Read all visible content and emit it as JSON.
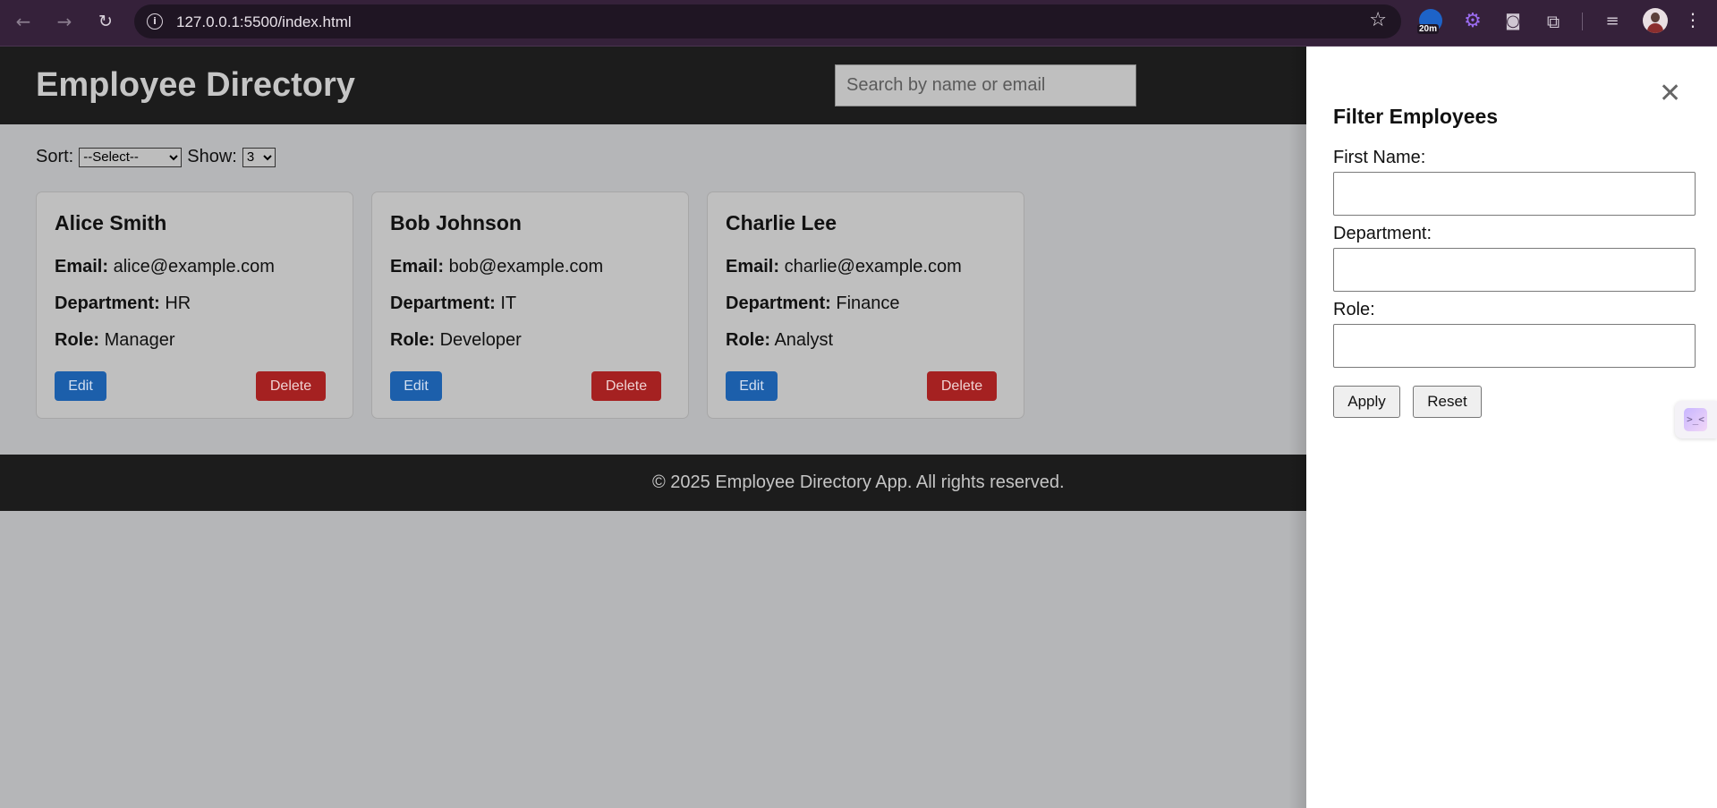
{
  "browser": {
    "url": "127.0.0.1:5500/index.html",
    "extension_badge": "20m",
    "icons": [
      "back-arrow-icon",
      "forward-arrow-icon",
      "reload-icon",
      "info-icon",
      "star-icon",
      "gear-icon",
      "camera-icon",
      "puzzle-icon",
      "queue-icon",
      "kebab-menu-icon"
    ]
  },
  "header": {
    "title": "Employee Directory",
    "search_placeholder": "Search by name or email"
  },
  "controls": {
    "sort_label": "Sort:",
    "sort_value": "--Select--",
    "show_label": "Show:",
    "show_value": "3"
  },
  "labels": {
    "email": "Email:",
    "department": "Department:",
    "role": "Role:"
  },
  "employees": [
    {
      "name": "Alice Smith",
      "email": "alice@example.com",
      "department": "HR",
      "role": "Manager"
    },
    {
      "name": "Bob Johnson",
      "email": "bob@example.com",
      "department": "IT",
      "role": "Developer"
    },
    {
      "name": "Charlie Lee",
      "email": "charlie@example.com",
      "department": "Finance",
      "role": "Analyst"
    }
  ],
  "card_actions": {
    "edit": "Edit",
    "delete": "Delete"
  },
  "footer": {
    "text": "© 2025 Employee Directory App. All rights reserved."
  },
  "filter_panel": {
    "title": "Filter Employees",
    "close": "✕",
    "first_name_label": "First Name:",
    "department_label": "Department:",
    "role_label": "Role:",
    "apply": "Apply",
    "reset": "Reset"
  },
  "colors": {
    "header_bg": "#1c1c1c",
    "edit_button": "#1c5fab",
    "delete_button": "#a52121",
    "overlay_bg": "#b5b6b8"
  }
}
